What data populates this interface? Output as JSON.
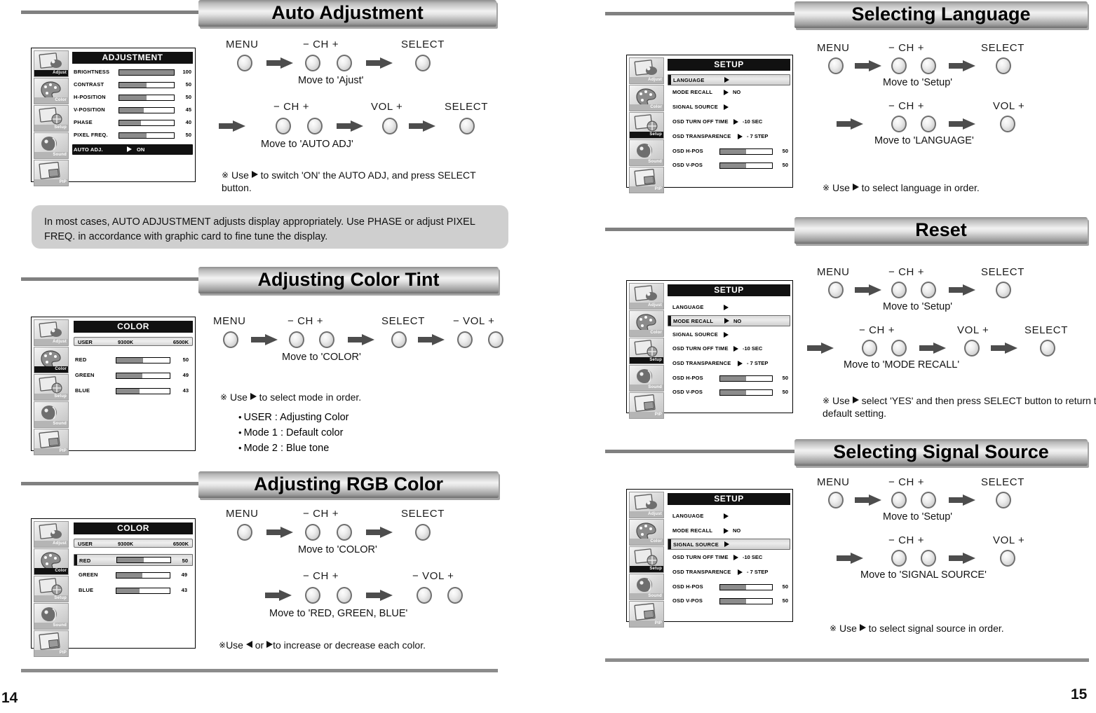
{
  "document": {
    "left_page_number": "14",
    "right_page_number": "15"
  },
  "icons": {
    "adjust": "adjust-icon",
    "color": "color-palette-icon",
    "setup": "setup-icon",
    "sound": "sound-icon",
    "pip": "pip-icon",
    "arrow_right": "arrow-right-icon",
    "triangle_right": "triangle-right-icon",
    "triangle_left": "triangle-left-icon",
    "note_mark": "reference-mark-icon"
  },
  "sidebar": {
    "items": [
      {
        "label": "Adjust"
      },
      {
        "label": "Color"
      },
      {
        "label": "Setup"
      },
      {
        "label": "Sound"
      },
      {
        "label": "PIP"
      }
    ]
  },
  "sections": [
    {
      "id": "auto-adjustment",
      "title": "Auto Adjustment",
      "osd": {
        "title": "ADJUSTMENT",
        "selected_sidebar": "Adjust",
        "rows": [
          {
            "label": "BRIGHTNESS",
            "value": "100",
            "fill": 100
          },
          {
            "label": "CONTRAST",
            "value": "50",
            "fill": 50
          },
          {
            "label": "H-POSITION",
            "value": "50",
            "fill": 50
          },
          {
            "label": "V-POSITION",
            "value": "45",
            "fill": 45
          },
          {
            "label": "PHASE",
            "value": "40",
            "fill": 40
          },
          {
            "label": "PIXEL FREQ.",
            "value": "50",
            "fill": 50
          }
        ],
        "auto_row": {
          "label": "AUTO ADJ.",
          "option": "ON"
        }
      },
      "flow": [
        {
          "buttons": [
            "MENU"
          ],
          "labels": [
            "MENU"
          ],
          "caption": ""
        },
        {
          "buttons": [
            "CH-",
            "CH+"
          ],
          "labels": [
            "−  CH  +"
          ],
          "caption": "Move to 'Ajust'"
        },
        {
          "buttons": [
            "SELECT"
          ],
          "labels": [
            "SELECT"
          ],
          "caption": ""
        },
        {
          "buttons": [
            "CH-",
            "CH+"
          ],
          "labels": [
            "−  CH  +"
          ],
          "caption": "Move to 'AUTO ADJ'"
        },
        {
          "buttons": [
            "VOL+"
          ],
          "labels": [
            "VOL  +"
          ],
          "caption": ""
        },
        {
          "buttons": [
            "SELECT"
          ],
          "labels": [
            "SELECT"
          ],
          "caption": ""
        }
      ],
      "note": "Use ▶ to switch 'ON' the AUTO ADJ, and press SELECT button.",
      "note_parts": {
        "before": "Use",
        "after": "to switch 'ON' the AUTO ADJ, and press SELECT button."
      }
    },
    {
      "id": "adjusting-color-tint",
      "title": "Adjusting Color Tint",
      "osd": {
        "title": "COLOR",
        "selected_sidebar": "Color",
        "presets": [
          "USER",
          "9300K",
          "6500K"
        ],
        "rows": [
          {
            "label": "RED",
            "value": "50",
            "fill": 50
          },
          {
            "label": "GREEN",
            "value": "49",
            "fill": 49
          },
          {
            "label": "BLUE",
            "value": "43",
            "fill": 43
          }
        ]
      },
      "note_parts": {
        "before": "Use",
        "after": "to select mode in order."
      },
      "bullets": [
        "USER : Adjusting Color",
        "Mode 1 : Default color",
        "Mode 2 : Blue tone"
      ]
    },
    {
      "id": "adjusting-rgb-color",
      "title": "Adjusting RGB Color",
      "osd": {
        "title": "COLOR",
        "selected_sidebar": "Color",
        "presets": [
          "USER",
          "9300K",
          "6500K"
        ],
        "rows": [
          {
            "label": "RED",
            "value": "50",
            "fill": 50,
            "highlight": true
          },
          {
            "label": "GREEN",
            "value": "49",
            "fill": 49
          },
          {
            "label": "BLUE",
            "value": "43",
            "fill": 43
          }
        ]
      },
      "note_parts": {
        "before": "Use",
        "middle": "or",
        "after": "to increase or decrease each color."
      }
    },
    {
      "id": "selecting-language",
      "title": "Selecting Language",
      "osd": {
        "title": "SETUP",
        "selected_sidebar": "Setup",
        "highlight_row": "LANGUAGE"
      },
      "note_parts": {
        "before": "Use",
        "after": "to select language in order."
      }
    },
    {
      "id": "reset",
      "title": "Reset",
      "osd": {
        "title": "SETUP",
        "selected_sidebar": "Setup",
        "highlight_row": "MODE RECALL"
      },
      "note_parts": {
        "before": "Use",
        "after": "select 'YES' and then press SELECT button to return to default setting."
      }
    },
    {
      "id": "selecting-signal-source",
      "title": "Selecting Signal Source",
      "osd": {
        "title": "SETUP",
        "selected_sidebar": "Setup",
        "highlight_row": "SIGNAL SOURCE"
      },
      "note_parts": {
        "before": "Use",
        "after": "to select signal source in order."
      }
    }
  ],
  "setup_menu": {
    "title": "SETUP",
    "rows": [
      {
        "label": "LANGUAGE",
        "option": "",
        "type": "arrow"
      },
      {
        "label": "MODE RECALL",
        "option": "NO",
        "type": "arrow"
      },
      {
        "label": "SIGNAL SOURCE",
        "option": "",
        "type": "arrow"
      },
      {
        "label": "OSD TURN OFF TIME",
        "option": "-10 SEC",
        "type": "arrow"
      },
      {
        "label": "OSD TRANSPARENCE",
        "option": "- 7 STEP",
        "type": "arrow"
      },
      {
        "label": "OSD H-POS",
        "value": "50",
        "fill": 50,
        "type": "bar"
      },
      {
        "label": "OSD V-POS",
        "value": "50",
        "fill": 50,
        "type": "bar"
      }
    ]
  },
  "note_box": {
    "text": "In most cases, AUTO ADJUSTMENT adjusts display appropriately. Use PHASE or adjust PIXEL FREQ. in accordance with graphic card to fine tune the display."
  },
  "button_labels": {
    "menu": "MENU",
    "ch": "−  CH  +",
    "select": "SELECT",
    "vol_plus": "VOL  +",
    "vol_minus_plus": "−  VOL  +"
  },
  "captions": {
    "move_ajust": "Move to 'Ajust'",
    "move_auto_adj": "Move to 'AUTO ADJ'",
    "move_color": "Move to 'COLOR'",
    "move_rgb": "Move to 'RED, GREEN, BLUE'",
    "move_setup": "Move to 'Setup'",
    "move_language": "Move to 'LANGUAGE'",
    "move_mode_recall": "Move to 'MODE RECALL'",
    "move_signal_source": "Move to 'SIGNAL SOURCE'"
  }
}
